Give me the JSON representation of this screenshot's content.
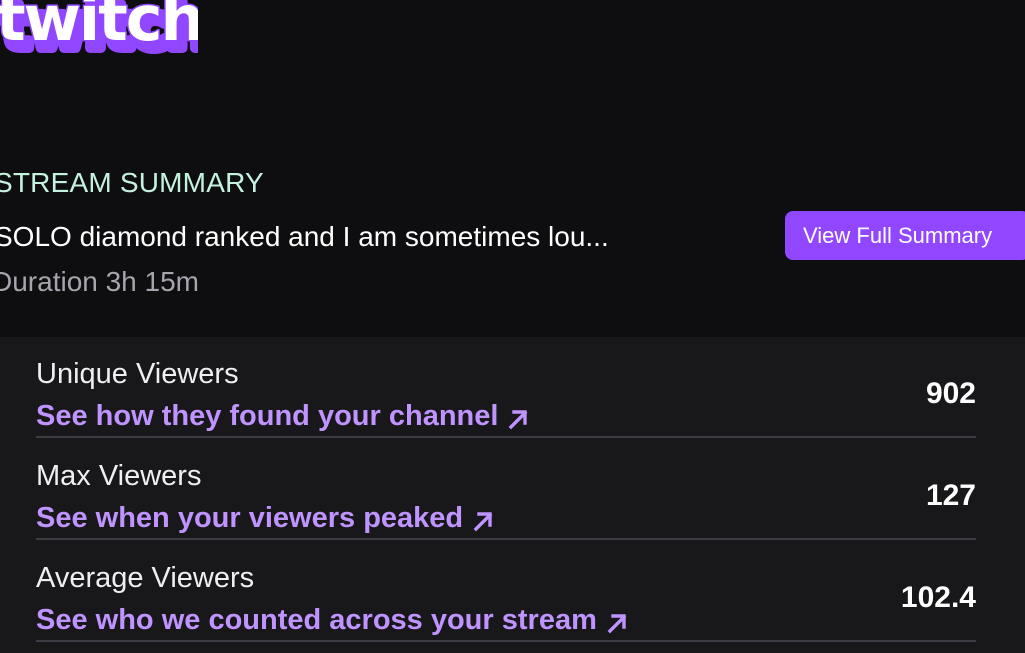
{
  "brand": {
    "logo_text": "twitch",
    "color": "#9147ff"
  },
  "summary": {
    "heading": "STREAM SUMMARY",
    "stream_title": "SOLO diamond ranked and I am sometimes lou...",
    "duration": "Duration 3h 15m",
    "view_full_button": "View Full Summary"
  },
  "stats": [
    {
      "label": "Unique Viewers",
      "link": "See how they found your channel",
      "value": "902",
      "link_icon": "arrow-up-right-icon"
    },
    {
      "label": "Max Viewers",
      "link": "See when your viewers peaked",
      "value": "127",
      "link_icon": "arrow-up-right-icon"
    },
    {
      "label": "Average Viewers",
      "link": "See who we counted across your stream",
      "value": "102.4",
      "link_icon": "arrow-up-right-icon"
    }
  ],
  "colors": {
    "background": "#0e0e10",
    "panel": "#18181b",
    "heading_accent": "#c5f2de",
    "link": "#bf94ff",
    "button": "#9147ff"
  }
}
